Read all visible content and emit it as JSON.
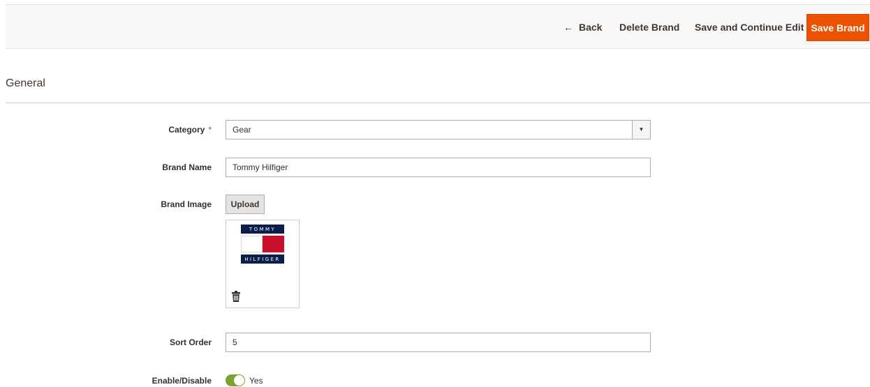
{
  "header": {
    "back_label": "Back",
    "back_arrow": "←",
    "delete_label": "Delete Brand",
    "save_continue_label": "Save and Continue Edit",
    "save_label": "Save Brand",
    "accent_color": "#eb5202"
  },
  "section": {
    "title": "General"
  },
  "form": {
    "category": {
      "label": "Category",
      "required_mark": "*",
      "value": "Gear"
    },
    "brand_name": {
      "label": "Brand Name",
      "value": "Tommy Hilfiger"
    },
    "brand_image": {
      "label": "Brand Image",
      "upload_label": "Upload",
      "logo_top_text": "TOMMY",
      "logo_bottom_text": "HILFIGER",
      "delete_icon": "trash-icon"
    },
    "sort_order": {
      "label": "Sort Order",
      "value": "5"
    },
    "enable": {
      "label": "Enable/Disable",
      "state_label": "Yes",
      "on": true,
      "toggle_color": "#79a22e"
    }
  }
}
